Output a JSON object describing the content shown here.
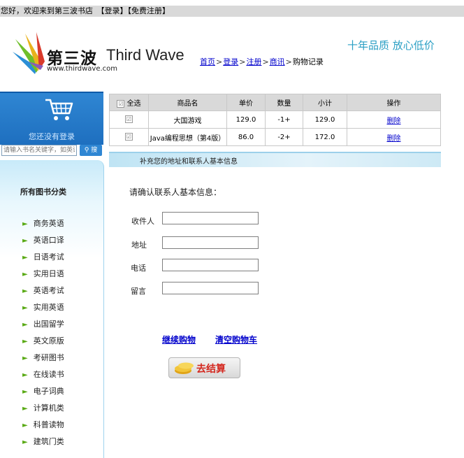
{
  "topbar": {
    "text": "您好，欢迎来到第三波书店　【登录】【免费注册】"
  },
  "header": {
    "logo_cn": "第三波",
    "logo_en": "Third Wave",
    "logo_url": "www.thirdwave.com",
    "slogan": "十年品质  放心低价",
    "breadcrumb": [
      {
        "label": "首页",
        "link": true
      },
      {
        "label": "登录",
        "link": true
      },
      {
        "label": "注册",
        "link": true
      },
      {
        "label": "商讯",
        "link": true
      },
      {
        "label": "购物记录",
        "link": false
      }
    ],
    "separator": ">"
  },
  "sidebar": {
    "login_msg": "您还没有登录",
    "search_placeholder": "请输入书名关键字，如英语",
    "search_button": "搜",
    "categories_title": "所有图书分类",
    "categories": [
      "商务英语",
      "英语口译",
      "日语考试",
      "实用日语",
      "英语考试",
      "实用英语",
      "出国留学",
      "英文原版",
      "考研图书",
      "在线读书",
      "电子词典",
      "计算机类",
      "科普读物",
      "建筑门类"
    ]
  },
  "cart": {
    "headers": {
      "select_all": "全选",
      "name": "商品名",
      "price": "单价",
      "qty": "数量",
      "subtotal": "小计",
      "action": "操作"
    },
    "rows": [
      {
        "name": "大国游戏",
        "price": "129.0",
        "qty": "-1+",
        "subtotal": "129.0",
        "action": "删除"
      },
      {
        "name": "Java编程思想（第4版）",
        "price": "86.0",
        "qty": "-2+",
        "subtotal": "172.0",
        "action": "删除"
      }
    ]
  },
  "address_bar": "补充您的地址和联系人基本信息",
  "form": {
    "title": "请确认联系人基本信息：",
    "receiver_label": "收件人",
    "address_label": "地址",
    "phone_label": "电话",
    "note_label": "留言"
  },
  "actions": {
    "continue": "继续购物",
    "clear": "清空购物车",
    "checkout": "去结算"
  },
  "colors": {
    "accent_blue": "#2f86d3",
    "slogan": "#2a9fc4",
    "link": "#0000cc",
    "arrow_green": "#5aaa16",
    "checkout_red": "#d4281f"
  }
}
